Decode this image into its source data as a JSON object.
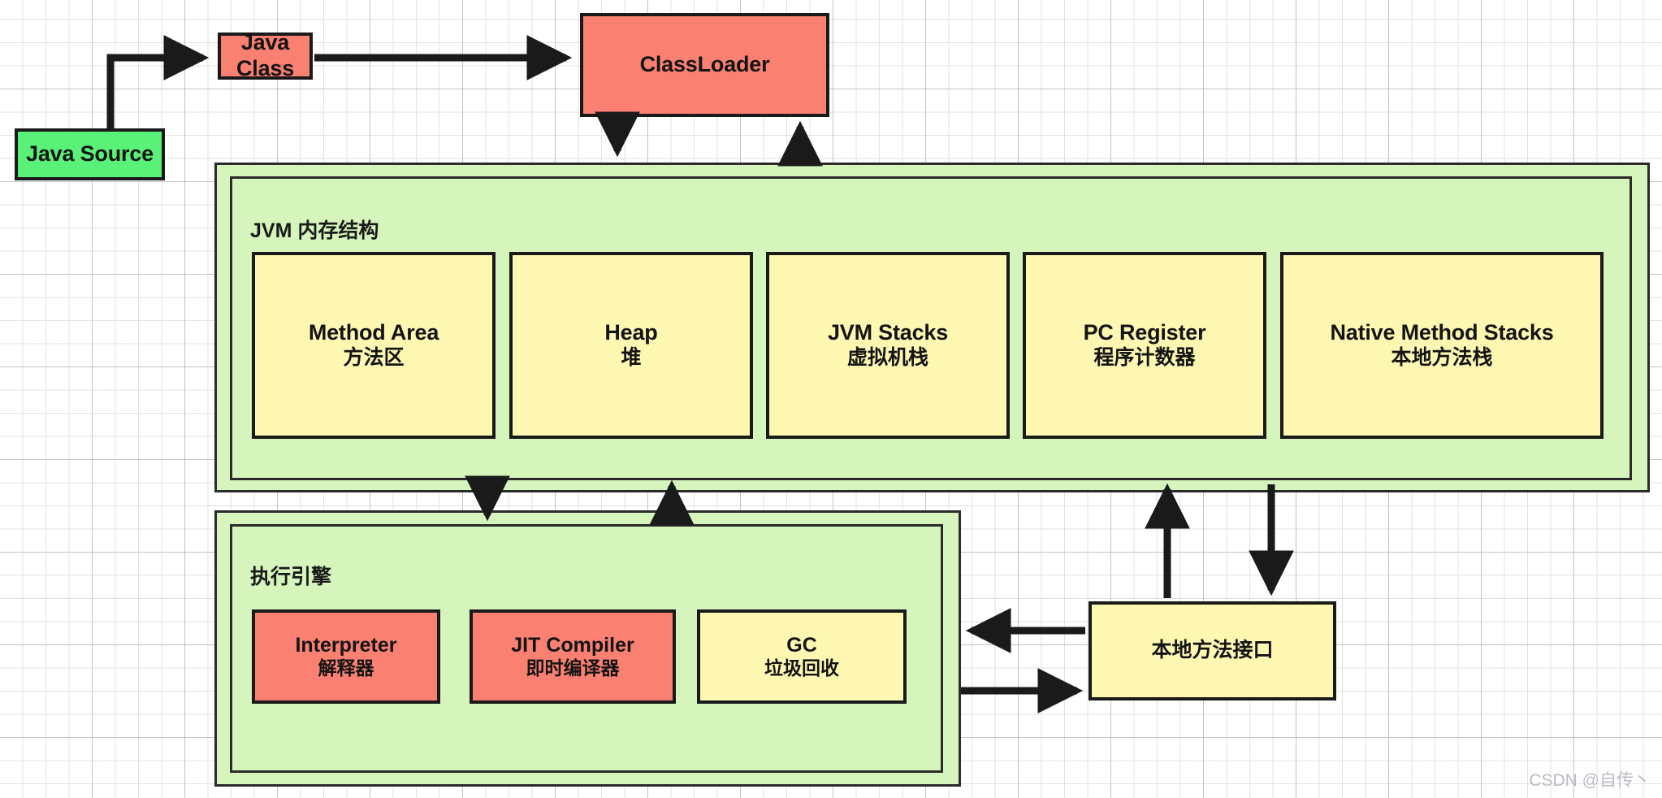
{
  "diagram": {
    "title": "JVM Architecture Diagram",
    "colors": {
      "red": "#fa8072",
      "green": "#59f177",
      "yellow": "#fdf7b2",
      "group_green": "#d6f5bc",
      "stroke": "#1a1a1a",
      "grid_minor": "#dddddd",
      "grid_major": "#aaaaaa",
      "watermark": "#b9bcc4"
    }
  },
  "pipeline": {
    "java_source": "Java Source",
    "java_class": "Java Class",
    "class_loader": "ClassLoader"
  },
  "memory": {
    "group_title": "JVM 内存结构",
    "areas": [
      {
        "en": "Method Area",
        "cn": "方法区"
      },
      {
        "en": "Heap",
        "cn": "堆"
      },
      {
        "en": "JVM Stacks",
        "cn": "虚拟机栈"
      },
      {
        "en": "PC Register",
        "cn": "程序计数器"
      },
      {
        "en": "Native Method Stacks",
        "cn": "本地方法栈"
      }
    ]
  },
  "execution_engine": {
    "group_title": "执行引擎",
    "components": [
      {
        "en": "Interpreter",
        "cn": "解释器",
        "color": "red"
      },
      {
        "en": "JIT Compiler",
        "cn": "即时编译器",
        "color": "red"
      },
      {
        "en": "GC",
        "cn": "垃圾回收",
        "color": "yellow"
      }
    ]
  },
  "native_interface": {
    "label": "本地方法接口"
  },
  "watermark": {
    "text": "CSDN @自传丶"
  }
}
